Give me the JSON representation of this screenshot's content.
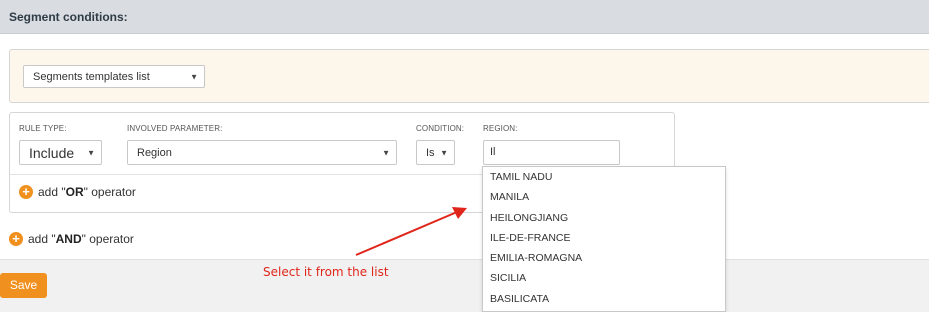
{
  "header": {
    "title": "Segment conditions:"
  },
  "templates": {
    "select_value": "Segments templates list"
  },
  "rule": {
    "labels": {
      "rule_type": "RULE TYPE:",
      "involved_parameter": "INVOLVED PARAMETER:",
      "condition": "CONDITION:",
      "region": "REGION:"
    },
    "rule_type_value": "Include",
    "involved_parameter_value": "Region",
    "condition_value": "Is",
    "region_input_value": "Il"
  },
  "operators": {
    "or_prefix": "add \"",
    "or_word": "OR",
    "or_suffix": "\" operator",
    "and_prefix": "add \"",
    "and_word": "AND",
    "and_suffix": "\" operator"
  },
  "dropdown": {
    "items": [
      "TAMIL NADU",
      "MANILA",
      "HEILONGJIANG",
      "ILE-DE-FRANCE",
      "EMILIA-ROMAGNA",
      "SICILIA",
      "BASILICATA"
    ]
  },
  "annotation": {
    "text": "Select it from the list",
    "color": "#e0261b"
  },
  "footer": {
    "save_label": "Save"
  },
  "colors": {
    "accent": "#f0901e",
    "header_bg": "#d9dde2",
    "panel_bg": "#fdf6ea"
  },
  "icons": [
    "plus-icon",
    "chevron-down-icon"
  ]
}
